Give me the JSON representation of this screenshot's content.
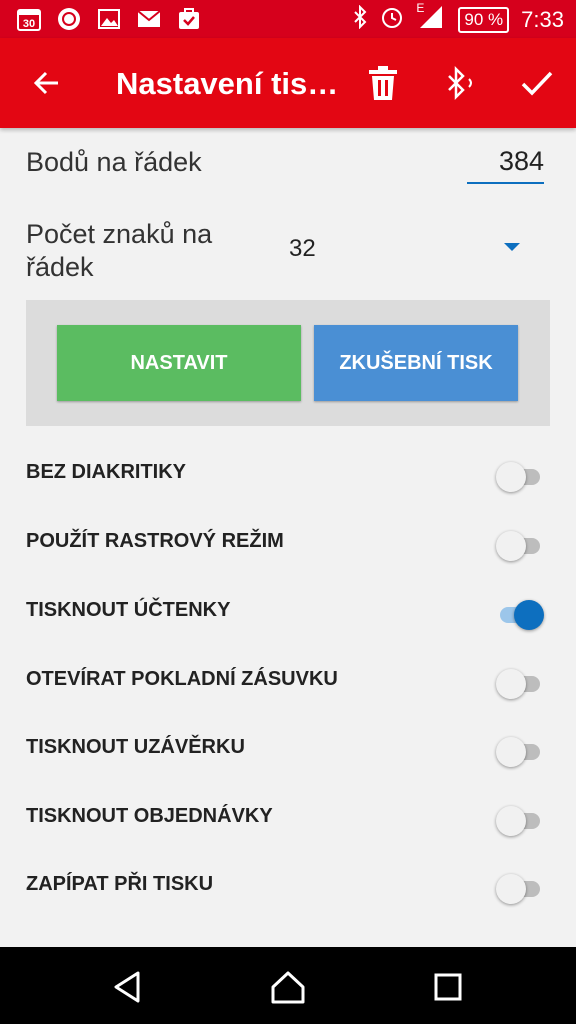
{
  "status_bar": {
    "calendar_day": "30",
    "battery": "90 %",
    "time": "7:33",
    "network_type": "E",
    "icons": [
      "calendar-icon",
      "mi-icon",
      "gallery-icon",
      "gmail-icon",
      "task-icon",
      "bluetooth-icon",
      "alarm-icon",
      "signal-icon",
      "battery-icon"
    ]
  },
  "app_bar": {
    "title": "Nastavení tis…",
    "actions": [
      "back-arrow-icon",
      "delete-icon",
      "bluetooth-connect-icon",
      "confirm-check-icon"
    ],
    "color": "#e30613"
  },
  "settings": {
    "bodu_label": "Bodů na řádek",
    "bodu_value": "384",
    "pocet_label": "Počet znaků na řádek",
    "pocet_value": "32"
  },
  "buttons": {
    "set_label": "NASTAVIT",
    "test_print_label": "ZKUŠEBNÍ TISK",
    "set_color": "#5bbc61",
    "test_color": "#4a8fd4"
  },
  "toggles": [
    {
      "label": "BEZ DIAKRITIKY",
      "on": false
    },
    {
      "label": "POUŽÍT RASTROVÝ REŽIM",
      "on": false
    },
    {
      "label": "TISKNOUT ÚČTENKY",
      "on": true
    },
    {
      "label": "OTEVÍRAT POKLADNÍ ZÁSUVKU",
      "on": false
    },
    {
      "label": "TISKNOUT UZÁVĚRKU",
      "on": false
    },
    {
      "label": "TISKNOUT OBJEDNÁVKY",
      "on": false
    },
    {
      "label": "ZAPÍPAT PŘI TISKU",
      "on": false
    }
  ],
  "nav_bar": {
    "icons": [
      "back-triangle-icon",
      "home-icon",
      "recents-icon"
    ]
  }
}
